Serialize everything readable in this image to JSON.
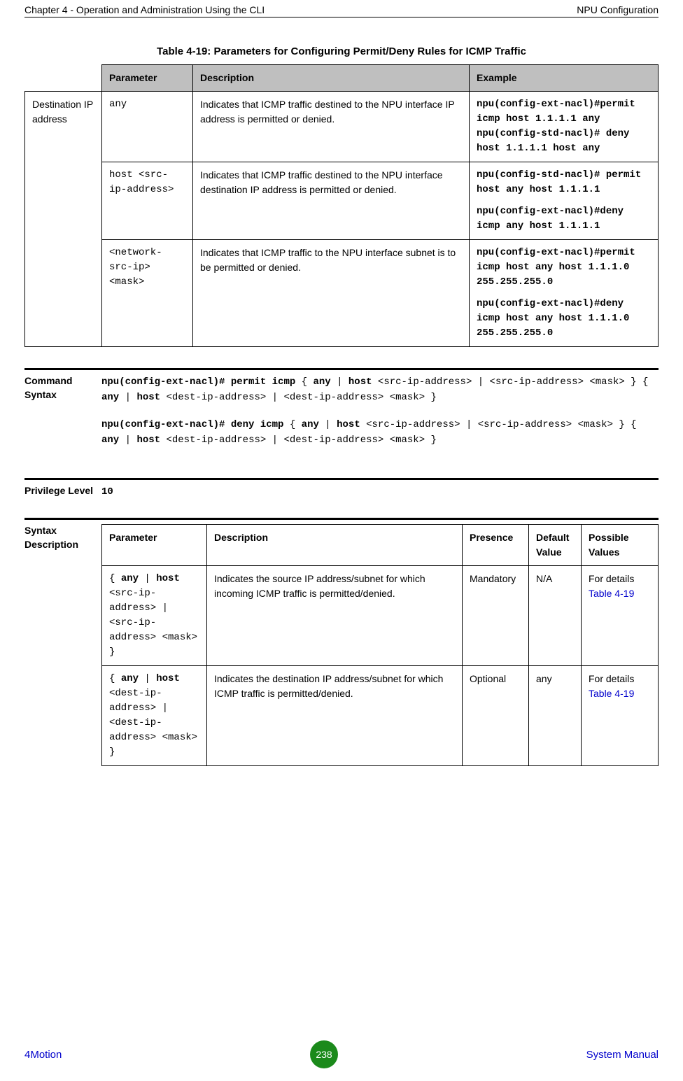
{
  "header": {
    "left": "Chapter 4 - Operation and Administration Using the CLI",
    "right": "NPU Configuration"
  },
  "table1": {
    "caption": "Table 4-19: Parameters for Configuring Permit/Deny Rules for ICMP Traffic",
    "headers": {
      "c1": "",
      "c2": "Parameter",
      "c3": "Description",
      "c4": "Example"
    },
    "rowgroup_label": "Destination IP address",
    "rows": [
      {
        "param": "any",
        "desc": "Indicates that ICMP traffic destined to the NPU interface IP address is permitted or denied.",
        "ex_lines": [
          "npu(config-ext-nacl)#permit icmp host 1.1.1.1 any",
          "npu(config-std-nacl)# deny host 1.1.1.1 host any"
        ]
      },
      {
        "param": "host <src-ip-address>",
        "desc": "Indicates that ICMP traffic destined to the NPU interface destination IP address is permitted or denied.",
        "ex_lines": [
          "npu(config-std-nacl)# permit host any host 1.1.1.1",
          "npu(config-ext-nacl)#deny icmp any host 1.1.1.1"
        ]
      },
      {
        "param": "<network-src-ip> <mask>",
        "desc": "Indicates that ICMP traffic to the NPU interface subnet is to be permitted or denied.",
        "ex_lines": [
          "npu(config-ext-nacl)#permit icmp host any host 1.1.1.0 255.255.255.0",
          "npu(config-ext-nacl)#deny icmp host any host 1.1.1.0 255.255.255.0"
        ]
      }
    ]
  },
  "command_syntax": {
    "label": "Command Syntax",
    "line1": {
      "p1": "npu(config-ext-nacl)# permit icmp",
      "p2": " { ",
      "p3": "any",
      "p4": " | ",
      "p5": "host",
      "p6": " <src-ip-address> | <src-ip-address> <mask> }  { ",
      "p7": "any",
      "p8": " | ",
      "p9": "host",
      "p10": " <dest-ip-address> | <dest-ip-address> <mask> }"
    },
    "line2": {
      "p1": "npu(config-ext-nacl)# deny icmp",
      "p2": " { ",
      "p3": "any",
      "p4": " | ",
      "p5": "host",
      "p6": " <src-ip-address> | <src-ip-address> <mask> }  { ",
      "p7": "any",
      "p8": " | ",
      "p9": "host",
      "p10": " <dest-ip-address> | <dest-ip-address> <mask> }"
    }
  },
  "privilege": {
    "label": "Privilege Level",
    "value": "10"
  },
  "syntax_desc": {
    "label": "Syntax Description",
    "headers": {
      "c1": "Parameter",
      "c2": "Description",
      "c3": "Presence",
      "c4": "Default Value",
      "c5": "Possible Values"
    },
    "rows": [
      {
        "param_pre": "{ ",
        "param_b1": "any",
        "param_mid1": " | ",
        "param_b2": "host",
        "param_post": " <src-ip-address> | <src-ip-address> <mask> }",
        "desc": "Indicates the source IP address/subnet for which incoming ICMP traffic is permitted/denied.",
        "presence": "Mandatory",
        "default": "N/A",
        "possible_pre": "For details ",
        "possible_link": "Table 4-19"
      },
      {
        "param_pre": "{ ",
        "param_b1": "any",
        "param_mid1": " | ",
        "param_b2": "host",
        "param_post": " <dest-ip-address> | <dest-ip-address> <mask> }",
        "desc": "Indicates the destination IP address/subnet for which ICMP traffic is permitted/denied.",
        "presence": "Optional",
        "default": "any",
        "possible_pre": "For details ",
        "possible_link": "Table 4-19"
      }
    ]
  },
  "footer": {
    "left": "4Motion",
    "page": "238",
    "right": "System Manual"
  }
}
